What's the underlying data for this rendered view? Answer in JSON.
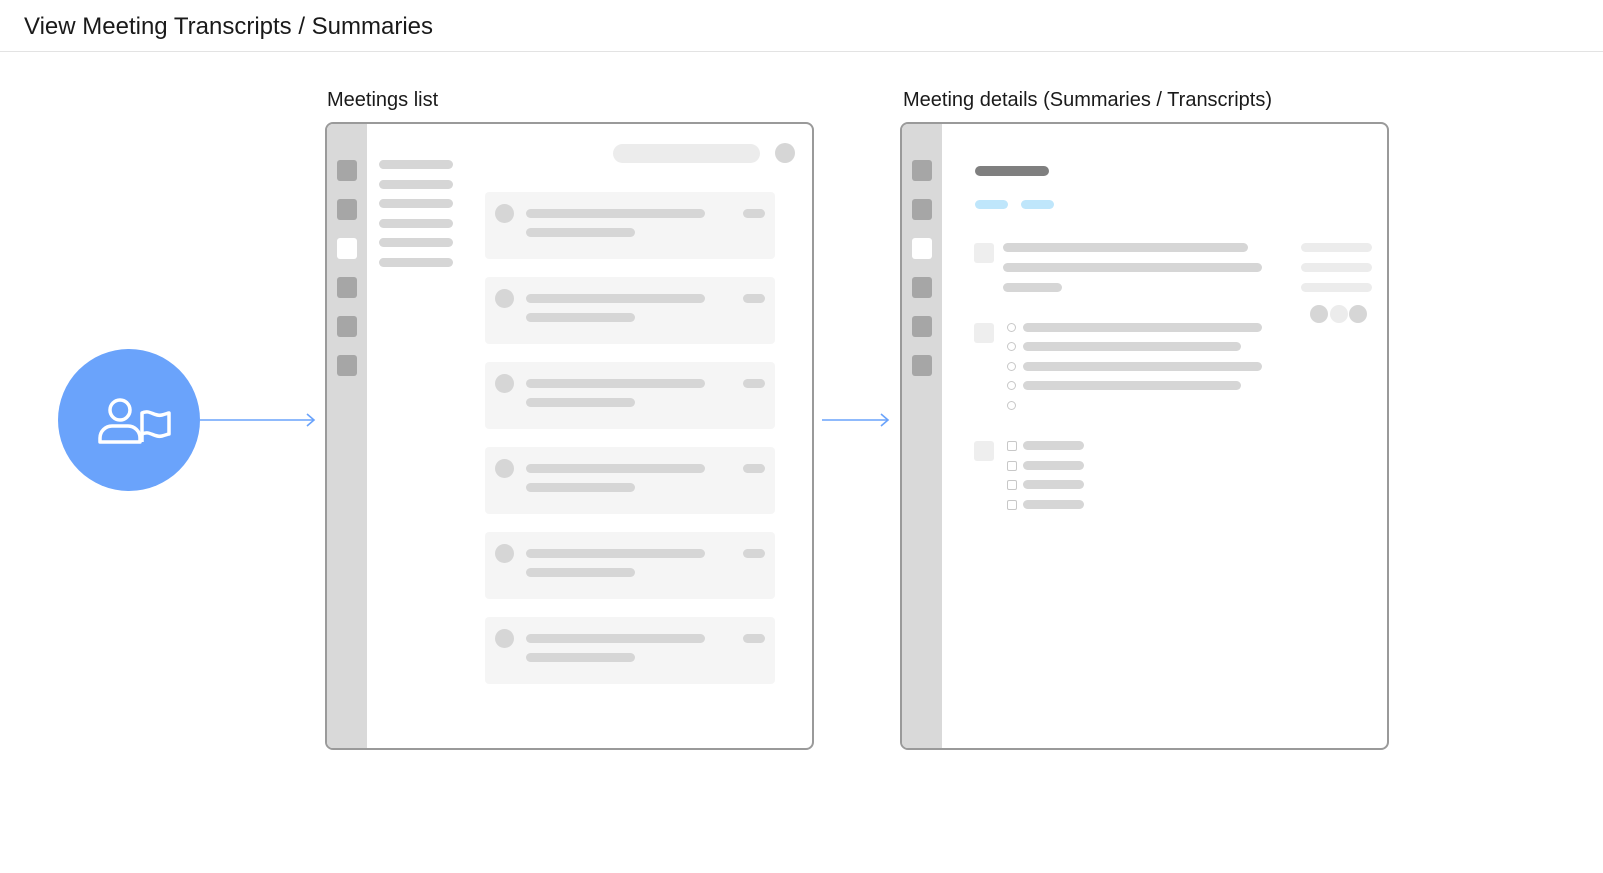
{
  "page": {
    "title": "View Meeting Transcripts / Summaries"
  },
  "persona": {
    "icon": "user-flag-icon",
    "color": "#6aa3fb"
  },
  "frames": {
    "meetings_list": {
      "label": "Meetings list",
      "sidebar_icons": 6,
      "active_icon_index": 2,
      "cards": 6
    },
    "meeting_details": {
      "label": "Meeting details (Summaries / Transcripts)",
      "sidebar_icons": 6,
      "active_icon_index": 2
    }
  },
  "colors": {
    "accent": "#6aa3fb",
    "tag": "#bfe6fb",
    "frame_border": "#9a9a9a",
    "rail": "#d9d9d9",
    "placeholder": "#d6d6d6"
  }
}
